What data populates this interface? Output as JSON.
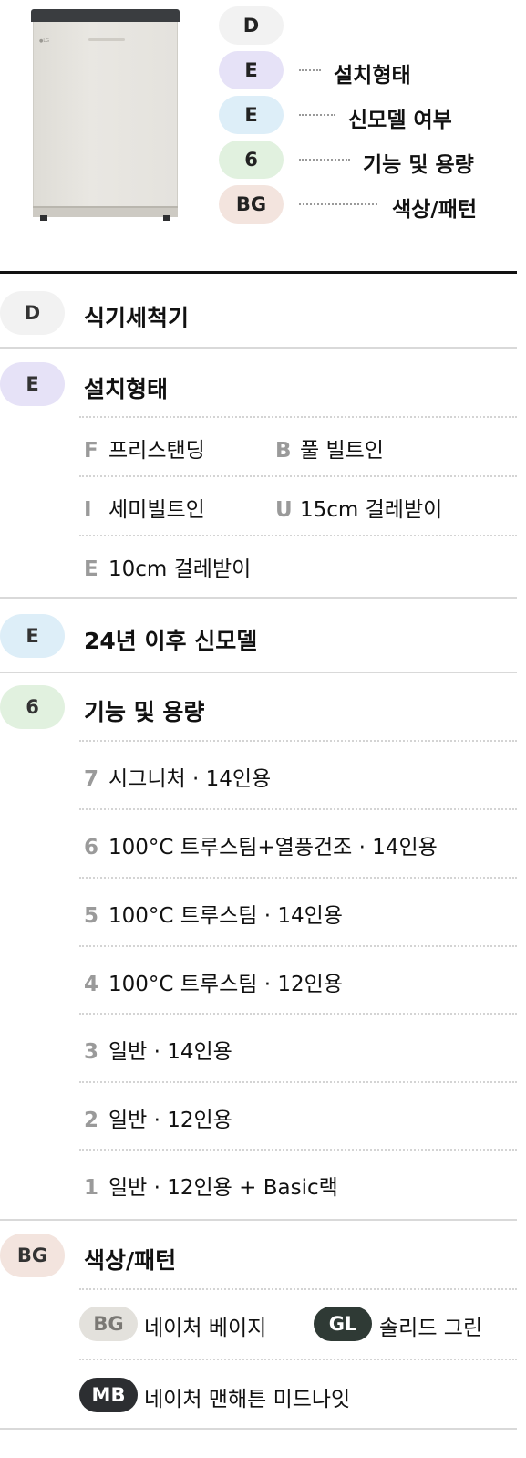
{
  "summary": {
    "rows": [
      {
        "code": "D",
        "label": ""
      },
      {
        "code": "E",
        "label": "설치형태"
      },
      {
        "code": "E",
        "label": "신모델 여부"
      },
      {
        "code": "6",
        "label": "기능 및 용량"
      },
      {
        "code": "BG",
        "label": "색상/패턴"
      }
    ]
  },
  "sections": {
    "product": {
      "code": "D",
      "title": "식기세척기"
    },
    "install": {
      "code": "E",
      "title": "설치형태",
      "options": [
        {
          "key": "F",
          "label": "프리스탠딩"
        },
        {
          "key": "B",
          "label": "풀 빌트인"
        },
        {
          "key": "I",
          "label": "세미빌트인"
        },
        {
          "key": "U",
          "label": "15cm 걸레받이"
        },
        {
          "key": "E",
          "label": "10cm 걸레받이"
        }
      ]
    },
    "model": {
      "code": "E",
      "title": "24년 이후 신모델"
    },
    "function": {
      "code": "6",
      "title": "기능 및 용량",
      "options": [
        {
          "key": "7",
          "label": "시그니처 · 14인용"
        },
        {
          "key": "6",
          "label": "100°C 트루스팀+열풍건조 · 14인용"
        },
        {
          "key": "5",
          "label": "100°C 트루스팀 · 14인용"
        },
        {
          "key": "4",
          "label": "100°C 트루스팀 · 12인용"
        },
        {
          "key": "3",
          "label": "일반 · 14인용"
        },
        {
          "key": "2",
          "label": "일반 · 12인용"
        },
        {
          "key": "1",
          "label": "일반 · 12인용 + Basic랙"
        }
      ]
    },
    "color": {
      "code": "BG",
      "title": "색상/패턴",
      "options": [
        {
          "key": "BG",
          "label": "네이처 베이지"
        },
        {
          "key": "GL",
          "label": "솔리드 그린"
        },
        {
          "key": "MB",
          "label": "네이처 맨해튼  미드나잇"
        }
      ]
    }
  },
  "colors": {
    "pill_d": "#f2f2f2",
    "pill_e": "#e6e2f7",
    "pill_e_model": "#ddeef8",
    "pill_6": "#e1f1df",
    "pill_bg": "#f3e4de",
    "chip_bg": "#e3e1dc",
    "chip_gl": "#2f3a35",
    "chip_mb": "#2c2e31"
  }
}
